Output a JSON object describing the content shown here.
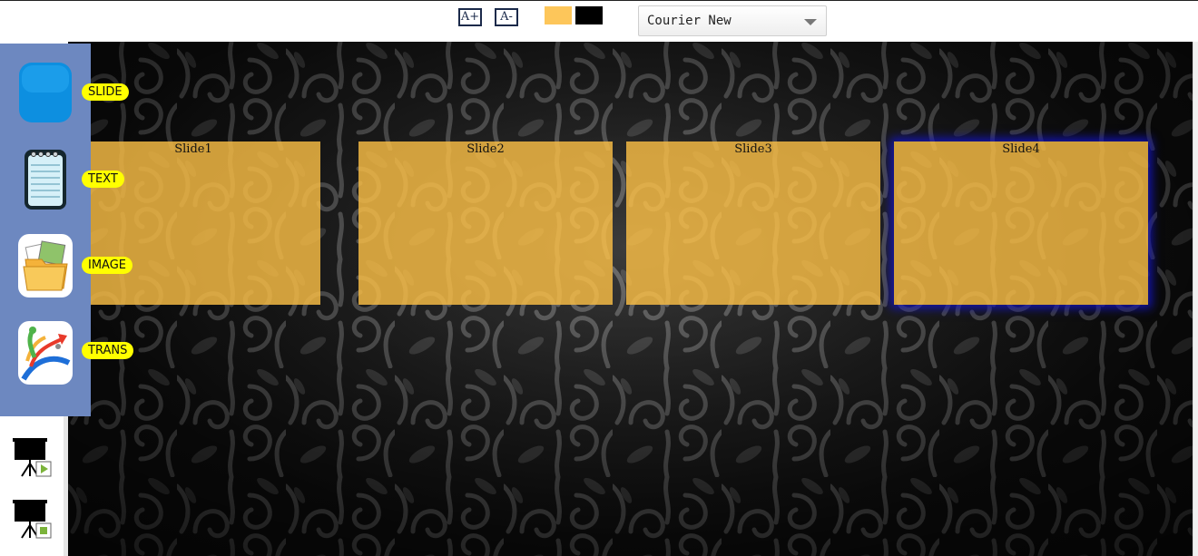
{
  "toolbar": {
    "font_increase": "A+",
    "font_decrease": "A-",
    "swatches": [
      {
        "name": "orange",
        "color": "#fdc65a"
      },
      {
        "name": "black",
        "color": "#000000"
      }
    ],
    "font_select": {
      "value": "Courier New"
    }
  },
  "tools": [
    {
      "label": "SLIDE",
      "icon": "slide-icon"
    },
    {
      "label": "TEXT",
      "icon": "notepad-icon"
    },
    {
      "label": "IMAGE",
      "icon": "image-folder-icon"
    },
    {
      "label": "TRANS",
      "icon": "transition-icon"
    }
  ],
  "slides": [
    {
      "label": "Slide1",
      "active": false
    },
    {
      "label": "Slide2",
      "active": false
    },
    {
      "label": "Slide3",
      "active": false
    },
    {
      "label": "Slide4",
      "active": true
    }
  ],
  "present_buttons": [
    {
      "icon": "presentation-play-icon"
    },
    {
      "icon": "presentation-stop-icon"
    }
  ],
  "colors": {
    "panel": "#6d88c0",
    "tag": "#ffff00",
    "slide_fill": "#fabe46",
    "active_glow": "#1414c8"
  }
}
